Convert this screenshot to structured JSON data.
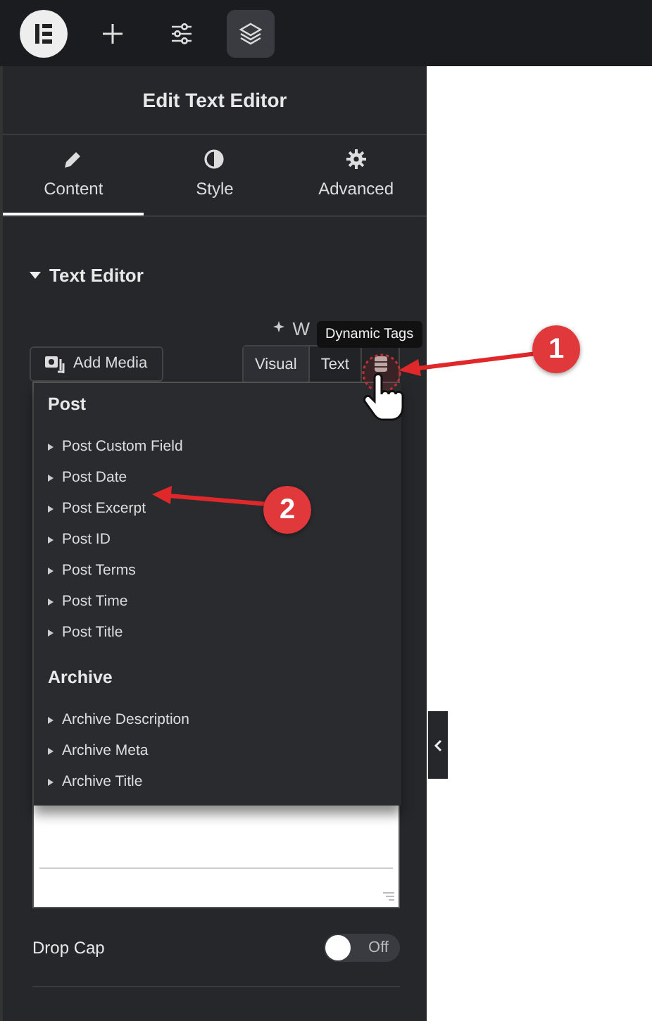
{
  "toolbar": {
    "buttons": [
      {
        "kind": "logo",
        "selected": false
      },
      {
        "kind": "add",
        "selected": false
      },
      {
        "kind": "settings",
        "selected": false
      },
      {
        "kind": "layers",
        "selected": true
      }
    ]
  },
  "panel": {
    "title": "Edit Text Editor",
    "tabs": [
      {
        "label": "Content",
        "kind": "pencil",
        "selected": true
      },
      {
        "label": "Style",
        "kind": "contrast",
        "selected": false
      },
      {
        "label": "Advanced",
        "kind": "gear",
        "selected": false
      }
    ]
  },
  "section": {
    "title": "Text Editor",
    "expanded": true
  },
  "ai_link": {
    "label": "W"
  },
  "media_button": {
    "label": "Add Media"
  },
  "editor_tabs": [
    {
      "label": "Visual",
      "selected": true
    },
    {
      "label": "Text",
      "selected": false
    }
  ],
  "tooltip": {
    "label": "Dynamic Tags"
  },
  "dropdown": {
    "groups": [
      {
        "title": "Post",
        "items": [
          "Post Custom Field",
          "Post Date",
          "Post Excerpt",
          "Post ID",
          "Post Terms",
          "Post Time",
          "Post Title"
        ]
      },
      {
        "title": "Archive",
        "items": [
          "Archive Description",
          "Archive Meta",
          "Archive Title"
        ]
      }
    ]
  },
  "drop_cap": {
    "label": "Drop Cap",
    "on": false,
    "state_label": "Off"
  },
  "annotations": [
    {
      "label": "1"
    },
    {
      "label": "2"
    }
  ]
}
